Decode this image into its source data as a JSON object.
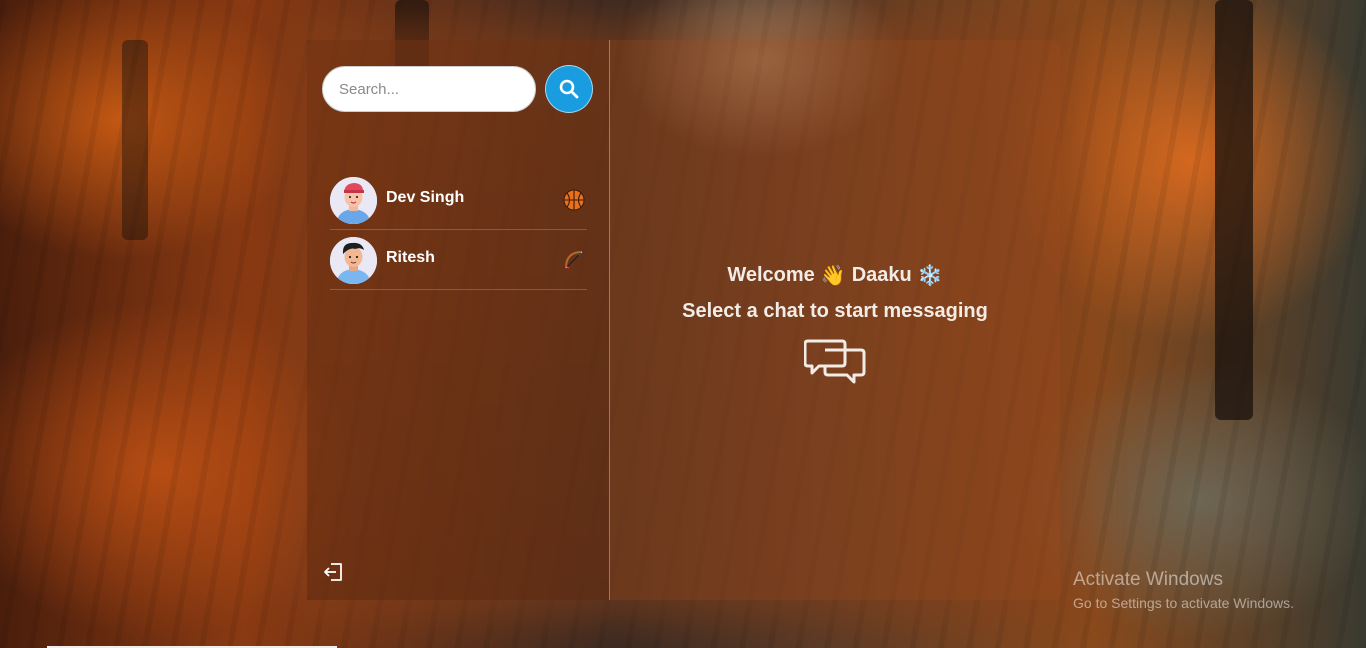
{
  "search": {
    "placeholder": "Search..."
  },
  "chats": [
    {
      "name": "Dev Singh",
      "emoji_icon": "basketball-icon"
    },
    {
      "name": "Ritesh",
      "emoji_icon": "bow-and-arrow-icon"
    }
  ],
  "welcome": {
    "prefix": "Welcome",
    "wave": "👋",
    "username": "Daaku",
    "snow": "❄️"
  },
  "prompt": "Select a chat to start messaging",
  "watermark": {
    "title": "Activate Windows",
    "subtitle": "Go to Settings to activate Windows."
  },
  "colors": {
    "accent": "#1a9de0",
    "text": "#f2ece6"
  }
}
